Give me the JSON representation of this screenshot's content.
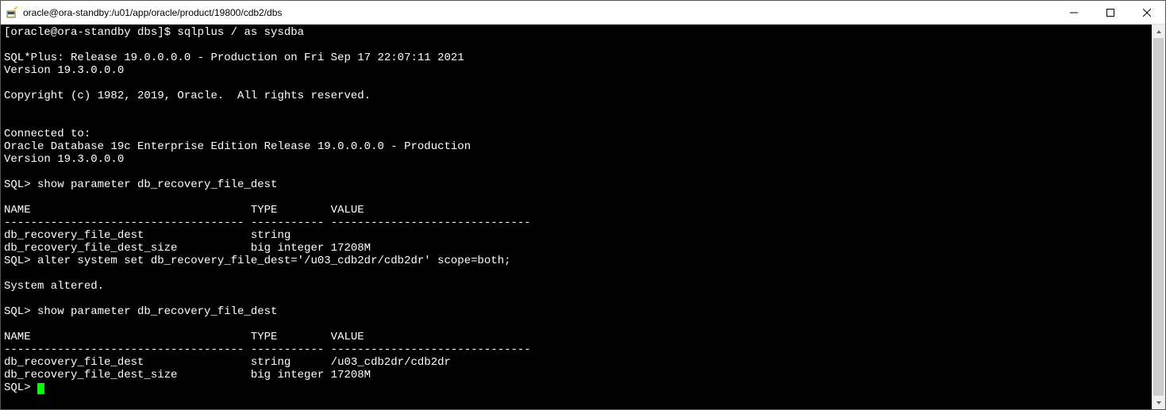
{
  "window": {
    "title": "oracle@ora-standby:/u01/app/oracle/product/19800/cdb2/dbs"
  },
  "terminal": {
    "lines": [
      "[oracle@ora-standby dbs]$ sqlplus / as sysdba",
      "",
      "SQL*Plus: Release 19.0.0.0.0 - Production on Fri Sep 17 22:07:11 2021",
      "Version 19.3.0.0.0",
      "",
      "Copyright (c) 1982, 2019, Oracle.  All rights reserved.",
      "",
      "",
      "Connected to:",
      "Oracle Database 19c Enterprise Edition Release 19.0.0.0.0 - Production",
      "Version 19.3.0.0.0",
      "",
      "SQL> show parameter db_recovery_file_dest",
      "",
      "NAME                                 TYPE        VALUE",
      "------------------------------------ ----------- ------------------------------",
      "db_recovery_file_dest                string",
      "db_recovery_file_dest_size           big integer 17208M",
      "SQL> alter system set db_recovery_file_dest='/u03_cdb2dr/cdb2dr' scope=both;",
      "",
      "System altered.",
      "",
      "SQL> show parameter db_recovery_file_dest",
      "",
      "NAME                                 TYPE        VALUE",
      "------------------------------------ ----------- ------------------------------",
      "db_recovery_file_dest                string      /u03_cdb2dr/cdb2dr",
      "db_recovery_file_dest_size           big integer 17208M"
    ],
    "promptLine": "SQL> "
  }
}
